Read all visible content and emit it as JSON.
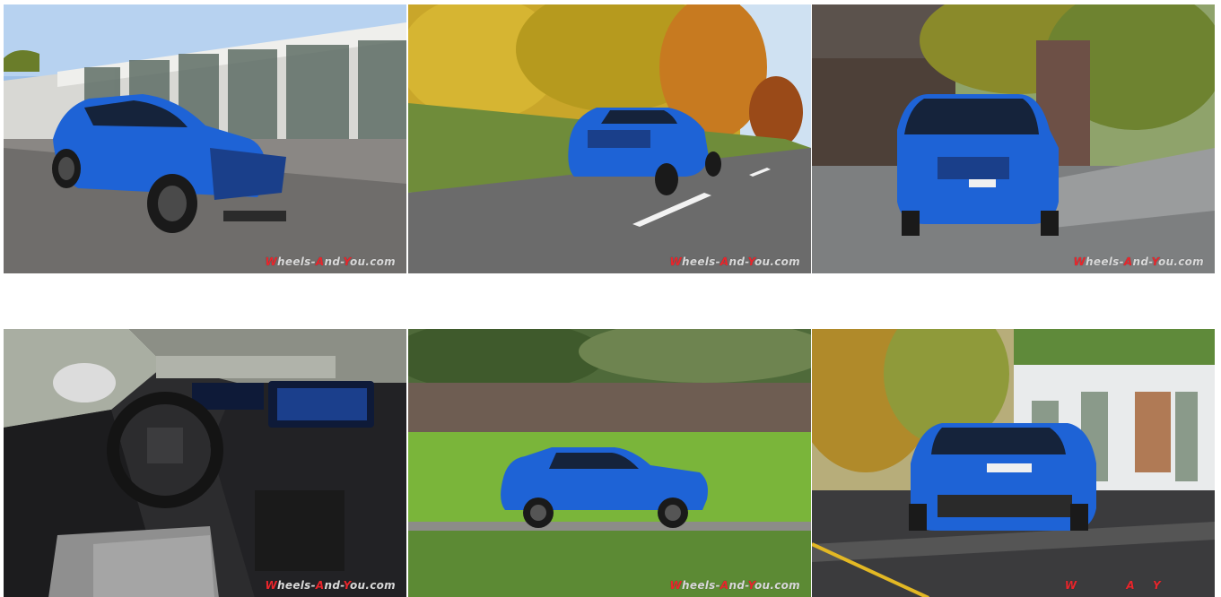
{
  "gallery": {
    "photos": [
      {
        "alt": "photo-1",
        "watermark": {
          "w": "W",
          "p1": "heels-",
          "a": "A",
          "p2": "nd-",
          "y": "Y",
          "p3": "ou.com"
        }
      },
      {
        "alt": "photo-2",
        "watermark": {
          "w": "W",
          "p1": "heels-",
          "a": "A",
          "p2": "nd-",
          "y": "Y",
          "p3": "ou.com"
        }
      },
      {
        "alt": "photo-3",
        "watermark": {
          "w": "W",
          "p1": "heels-",
          "a": "A",
          "p2": "nd-",
          "y": "Y",
          "p3": "ou.com"
        }
      },
      {
        "alt": "photo-4",
        "watermark": {
          "w": "W",
          "p1": "heels-",
          "a": "A",
          "p2": "nd-",
          "y": "Y",
          "p3": "ou.com"
        }
      },
      {
        "alt": "photo-5",
        "watermark": {
          "w": "W",
          "p1": "heels-",
          "a": "A",
          "p2": "nd-",
          "y": "Y",
          "p3": "ou.com"
        }
      },
      {
        "alt": "photo-6",
        "watermark": {
          "w": "W",
          "p1": "",
          "a": "A",
          "p2": "",
          "y": "Y",
          "p3": ""
        }
      }
    ]
  },
  "colors": {
    "car_blue": "#1e63d6",
    "watermark_red": "#e8262c"
  }
}
